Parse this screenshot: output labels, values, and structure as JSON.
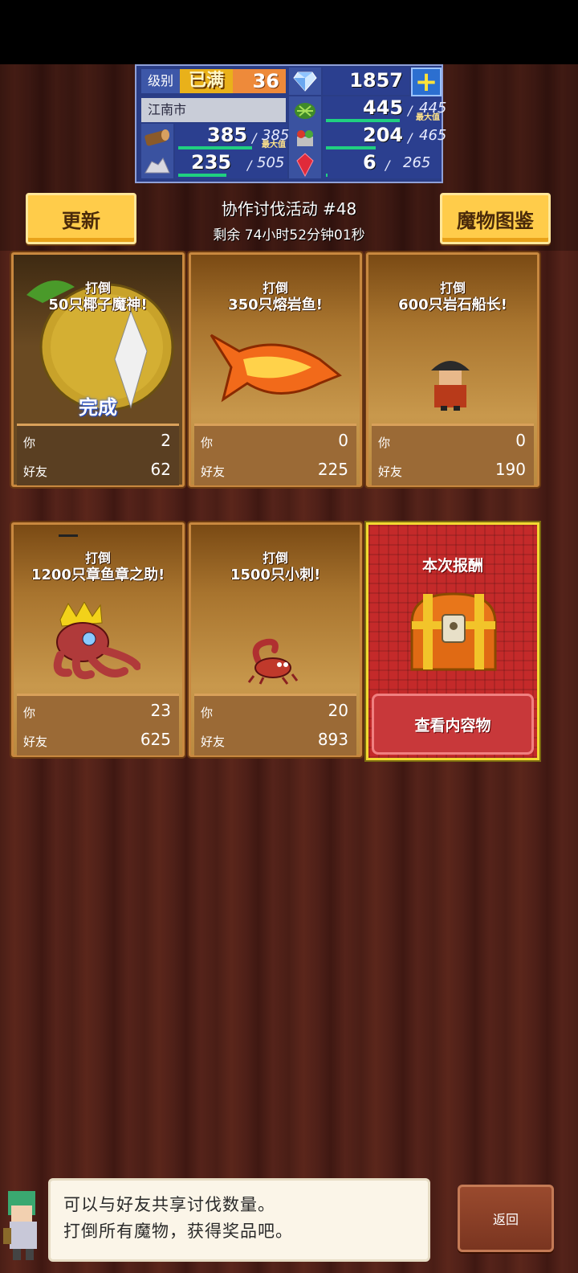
{
  "stats": {
    "level_label": "级别",
    "level_status": "已满",
    "level_value": "36",
    "gems": "1857",
    "city": "江南市",
    "rows": [
      {
        "icon": "grass-icon",
        "value": "445",
        "max": "445",
        "max_tag": "最大值",
        "fill": 1.0
      },
      {
        "icon": "wood-log-icon",
        "value": "385",
        "max": "385",
        "max_tag": "最大值",
        "fill": 1.0
      },
      {
        "icon": "food-basket-icon",
        "value": "204",
        "max": "465",
        "max_tag": "",
        "fill": 0.44
      },
      {
        "icon": "ore-pile-icon",
        "value": "235",
        "max": "505",
        "max_tag": "",
        "fill": 0.47
      },
      {
        "icon": "red-gem-icon",
        "value": "6",
        "max": "265",
        "max_tag": "",
        "fill": 0.02
      }
    ],
    "slash": "/"
  },
  "header": {
    "refresh_label": "更新",
    "title": "协作讨伐活动 #48",
    "time_left": "剩余 74小时52分钟01秒",
    "bestiary_label": "魔物图鉴"
  },
  "cards": [
    {
      "line1": "打倒",
      "line2": "50只椰子魔神!",
      "you_label": "你",
      "you": "2",
      "friend_label": "好友",
      "friends": "62",
      "status": "完成",
      "monster": "coconut-demon-icon"
    },
    {
      "line1": "打倒",
      "line2": "350只熔岩鱼!",
      "you_label": "你",
      "you": "0",
      "friend_label": "好友",
      "friends": "225",
      "monster": "lava-fish-icon"
    },
    {
      "line1": "打倒",
      "line2": "600只岩石船长!",
      "you_label": "你",
      "you": "0",
      "friend_label": "好友",
      "friends": "190",
      "monster": "rock-captain-icon"
    },
    {
      "line1": "打倒",
      "line2": "1200只章鱼章之助!",
      "you_label": "你",
      "you": "23",
      "friend_label": "好友",
      "friends": "625",
      "monster": "octopus-king-icon"
    },
    {
      "line1": "打倒",
      "line2": "1500只小刺!",
      "you_label": "你",
      "you": "20",
      "friend_label": "好友",
      "friends": "893",
      "monster": "scorpion-icon"
    }
  ],
  "reward": {
    "title": "本次报酬",
    "button": "查看内容物",
    "icon": "treasure-chest-icon"
  },
  "footer": {
    "line1": "可以与好友共享讨伐数量。",
    "line2": "打倒所有魔物，获得奖品吧。",
    "back_label": "返回"
  },
  "colors": {
    "accent_yellow": "#ffcc4a",
    "panel_blue": "#2a3d86",
    "reward_red": "#c42a2a",
    "bar_green": "#20d080"
  }
}
